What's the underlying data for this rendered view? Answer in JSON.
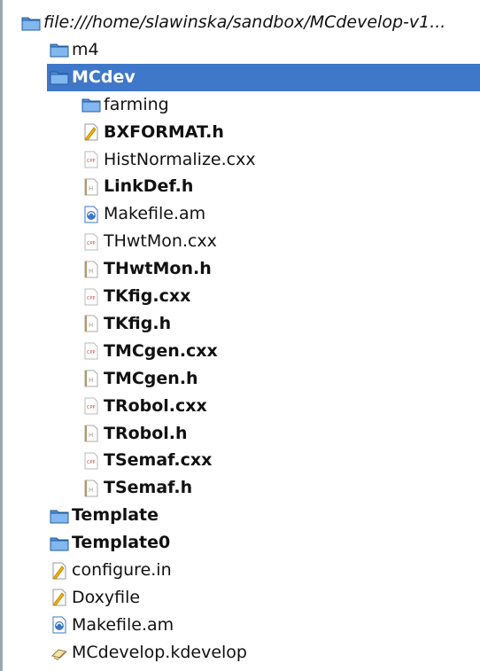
{
  "tree": {
    "items": [
      {
        "label": "file:///home/slawinska/sandbox/MCdevelop-v1...",
        "icon": "folder-icon",
        "indent": 1,
        "italic": true,
        "bold": false
      },
      {
        "label": "m4",
        "icon": "folder-icon",
        "indent": 2,
        "bold": false
      },
      {
        "label": "MCdev",
        "icon": "folder-open-icon",
        "indent": 2,
        "bold": true,
        "selected": true,
        "expanded": true
      },
      {
        "label": "farming",
        "icon": "folder-icon",
        "indent": 3,
        "bold": false
      },
      {
        "label": "BXFORMAT.h",
        "icon": "text-file-icon",
        "indent": 3,
        "bold": true
      },
      {
        "label": "HistNormalize.cxx",
        "icon": "cpp-file-icon",
        "indent": 3,
        "bold": false
      },
      {
        "label": "LinkDef.h",
        "icon": "header-file-icon",
        "indent": 3,
        "bold": true
      },
      {
        "label": "Makefile.am",
        "icon": "makefile-icon",
        "indent": 3,
        "bold": false
      },
      {
        "label": "THwtMon.cxx",
        "icon": "cpp-file-icon",
        "indent": 3,
        "bold": false
      },
      {
        "label": "THwtMon.h",
        "icon": "header-file-icon",
        "indent": 3,
        "bold": true
      },
      {
        "label": "TKfig.cxx",
        "icon": "cpp-file-icon",
        "indent": 3,
        "bold": true
      },
      {
        "label": "TKfig.h",
        "icon": "header-file-icon",
        "indent": 3,
        "bold": true
      },
      {
        "label": "TMCgen.cxx",
        "icon": "cpp-file-icon",
        "indent": 3,
        "bold": true
      },
      {
        "label": "TMCgen.h",
        "icon": "header-file-icon",
        "indent": 3,
        "bold": true
      },
      {
        "label": "TRobol.cxx",
        "icon": "cpp-file-icon",
        "indent": 3,
        "bold": true
      },
      {
        "label": "TRobol.h",
        "icon": "header-file-icon",
        "indent": 3,
        "bold": true
      },
      {
        "label": "TSemaf.cxx",
        "icon": "cpp-file-icon",
        "indent": 3,
        "bold": true
      },
      {
        "label": "TSemaf.h",
        "icon": "header-file-icon",
        "indent": 3,
        "bold": true
      },
      {
        "label": "Template",
        "icon": "folder-icon",
        "indent": 2,
        "bold": true
      },
      {
        "label": "Template0",
        "icon": "folder-icon",
        "indent": 2,
        "bold": true
      },
      {
        "label": "configure.in",
        "icon": "text-file-icon",
        "indent": 2,
        "bold": false
      },
      {
        "label": "Doxyfile",
        "icon": "text-file-icon",
        "indent": 2,
        "bold": false
      },
      {
        "label": "Makefile.am",
        "icon": "makefile-icon",
        "indent": 2,
        "bold": false
      },
      {
        "label": "MCdevelop.kdevelop",
        "icon": "project-file-icon",
        "indent": 2,
        "bold": false
      }
    ]
  }
}
